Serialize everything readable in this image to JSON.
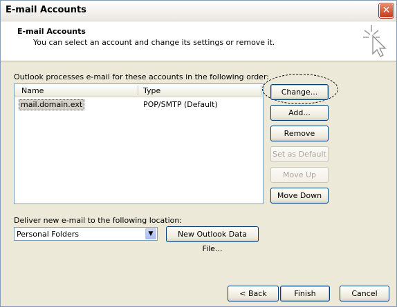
{
  "window": {
    "title": "E-mail Accounts"
  },
  "header": {
    "title": "E-mail Accounts",
    "subtitle": "You can select an account and change its settings or remove it."
  },
  "accounts": {
    "label": "Outlook processes e-mail for these accounts in the following order:",
    "columns": [
      "Name",
      "Type"
    ],
    "rows": [
      {
        "name": "mail.domain.ext",
        "type": "POP/SMTP (Default)"
      }
    ]
  },
  "buttons": {
    "change": "Change...",
    "add": "Add...",
    "remove": "Remove",
    "set_default": "Set as Default",
    "move_up": "Move Up",
    "move_down": "Move Down"
  },
  "delivery": {
    "label": "Deliver new e-mail to the following location:",
    "selected": "Personal Folders",
    "new_data_file": "New Outlook Data File..."
  },
  "footer": {
    "back": "< Back",
    "finish": "Finish",
    "cancel": "Cancel"
  }
}
